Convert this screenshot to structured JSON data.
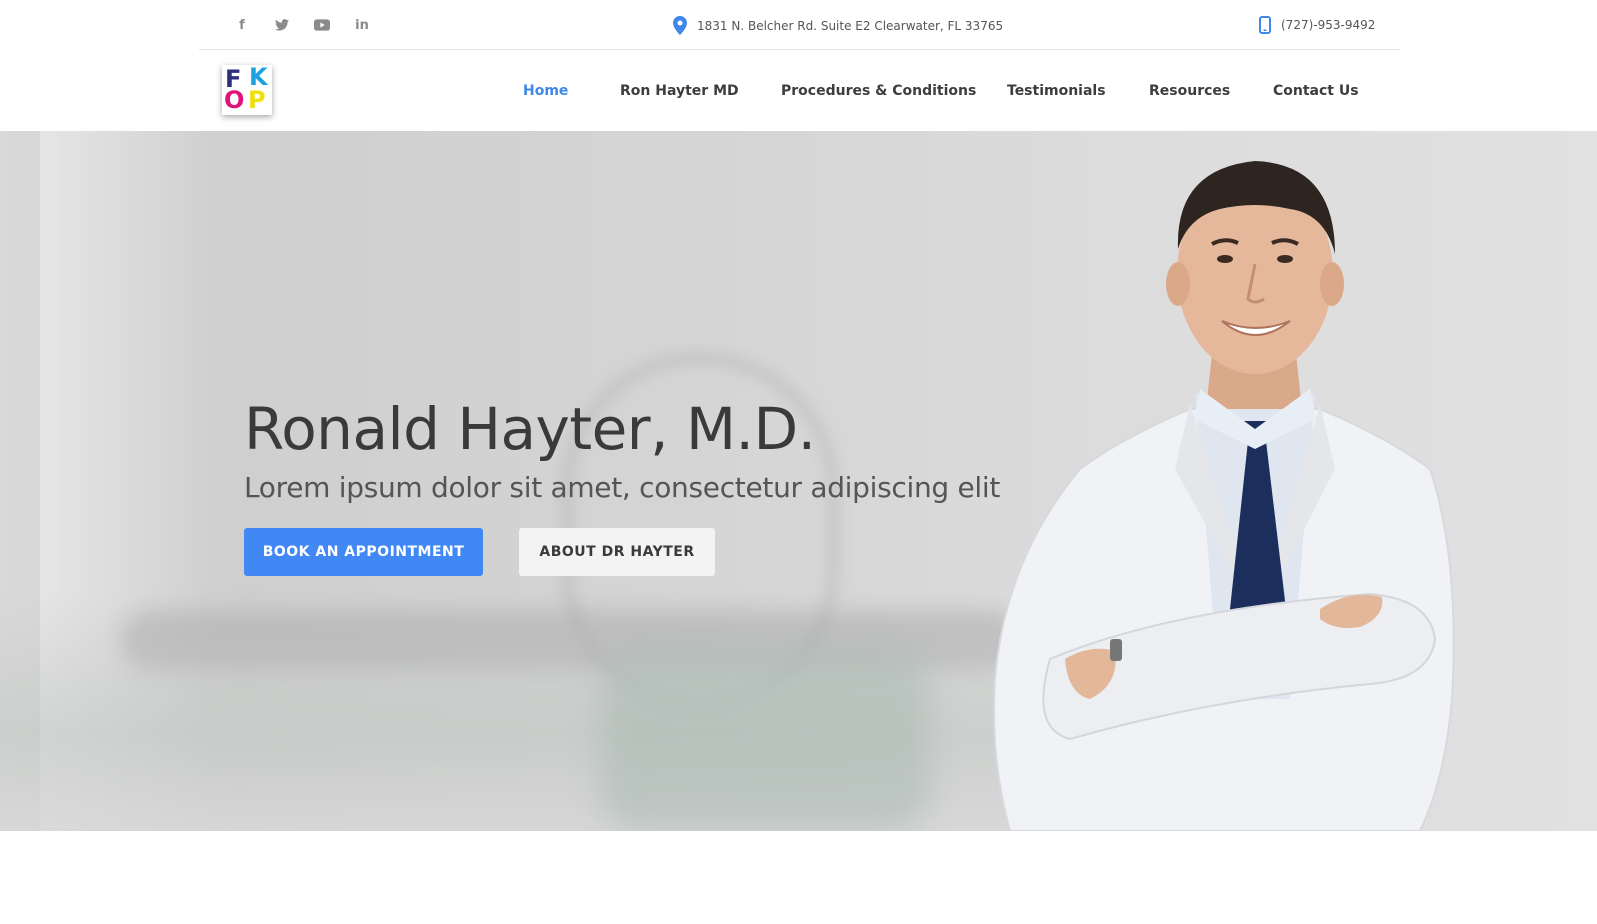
{
  "topbar": {
    "social": [
      {
        "name": "facebook-icon",
        "glyph": "f"
      },
      {
        "name": "twitter-icon",
        "glyph": "t"
      },
      {
        "name": "youtube-icon",
        "glyph": "▶"
      },
      {
        "name": "linkedin-icon",
        "glyph": "in"
      }
    ],
    "address": "1831 N. Belcher Rd. Suite E2 Clearwater, FL 33765",
    "phone": "(727)-953-9492"
  },
  "logo": {
    "letters": [
      "F",
      "K",
      "O",
      "P"
    ]
  },
  "nav": {
    "items": [
      {
        "label": "Home",
        "active": true
      },
      {
        "label": "Ron Hayter MD",
        "active": false
      },
      {
        "label": "Procedures & Conditions",
        "active": false
      },
      {
        "label": "Testimonials",
        "active": false
      },
      {
        "label": "Resources",
        "active": false
      },
      {
        "label": "Contact Us",
        "active": false
      }
    ]
  },
  "hero": {
    "title": "Ronald Hayter, M.D.",
    "subtitle": "Lorem ipsum dolor sit amet, consectetur adipiscing elit",
    "primary_button": "BOOK AN APPOINTMENT",
    "secondary_button": "ABOUT DR HAYTER"
  },
  "colors": {
    "accent": "#4288f4",
    "nav_active": "#3f87e8",
    "heading": "#3a3a3a"
  }
}
